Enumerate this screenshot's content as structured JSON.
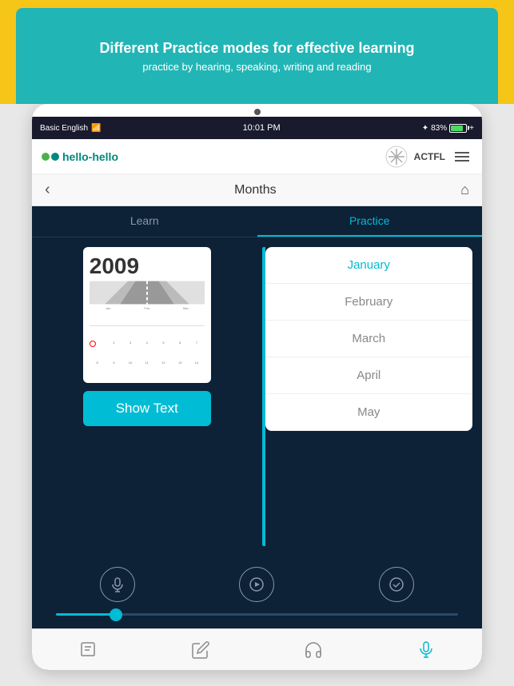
{
  "banner": {
    "title": "Different Practice modes for effective learning",
    "subtitle": "practice by hearing, speaking, writing and reading"
  },
  "status_bar": {
    "left": "Basic English",
    "time": "10:01 PM",
    "battery": "83%",
    "bluetooth": "✦"
  },
  "app_header": {
    "logo_text": "hello-hello",
    "actfl": "ACTFL"
  },
  "nav": {
    "title": "Months",
    "back": "‹",
    "home": "⌂"
  },
  "tabs": [
    {
      "label": "Learn",
      "active": false
    },
    {
      "label": "Practice",
      "active": true
    }
  ],
  "show_text_button": "Show Text",
  "months": [
    {
      "label": "January",
      "active": true
    },
    {
      "label": "February",
      "active": false
    },
    {
      "label": "March",
      "active": false
    },
    {
      "label": "April",
      "active": false
    },
    {
      "label": "May",
      "active": false
    }
  ],
  "bottom_nav": [
    {
      "icon": "📚",
      "name": "library",
      "active": false
    },
    {
      "icon": "✏️",
      "name": "write",
      "active": false
    },
    {
      "icon": "🎧",
      "name": "listen",
      "active": false
    },
    {
      "icon": "🎤",
      "name": "speak",
      "active": true
    }
  ],
  "colors": {
    "teal": "#00bcd4",
    "dark_bg": "#0d2137",
    "accent": "#f5c518",
    "banner_bg": "#22b5b5"
  }
}
